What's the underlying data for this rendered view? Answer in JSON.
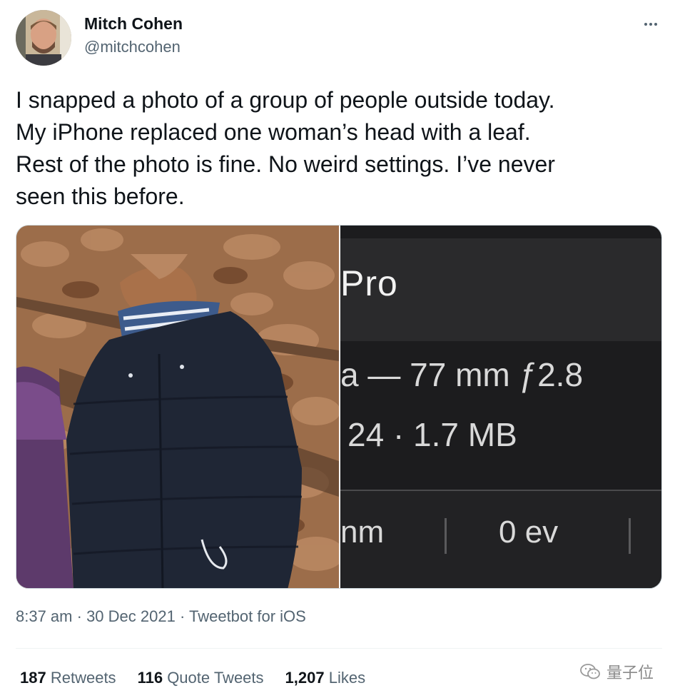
{
  "author": {
    "name": "Mitch Cohen",
    "handle": "@mitchcohen"
  },
  "tweet": {
    "text": "I snapped a photo of a group of people outside today.\nMy iPhone replaced one woman’s head with a leaf.\nRest of the photo is fine. No weird settings. I’ve never\nseen this before."
  },
  "photo_info": {
    "title": "Pro",
    "lens_line": "a — 77 mm ƒ2.8",
    "size_line": "24 · 1.7 MB",
    "cell1": "nm",
    "cell2": "0 ev"
  },
  "meta": {
    "time": "8:37 am",
    "sep1": " · ",
    "date": "30 Dec 2021",
    "sep2": " · ",
    "source": "Tweetbot for iOS"
  },
  "stats": {
    "retweets_count": "187",
    "retweets_label": "Retweets",
    "quotes_count": "116",
    "quotes_label": "Quote Tweets",
    "likes_count": "1,207",
    "likes_label": "Likes"
  },
  "watermark": {
    "text": "量子位",
    "icon": "wechat-icon"
  }
}
